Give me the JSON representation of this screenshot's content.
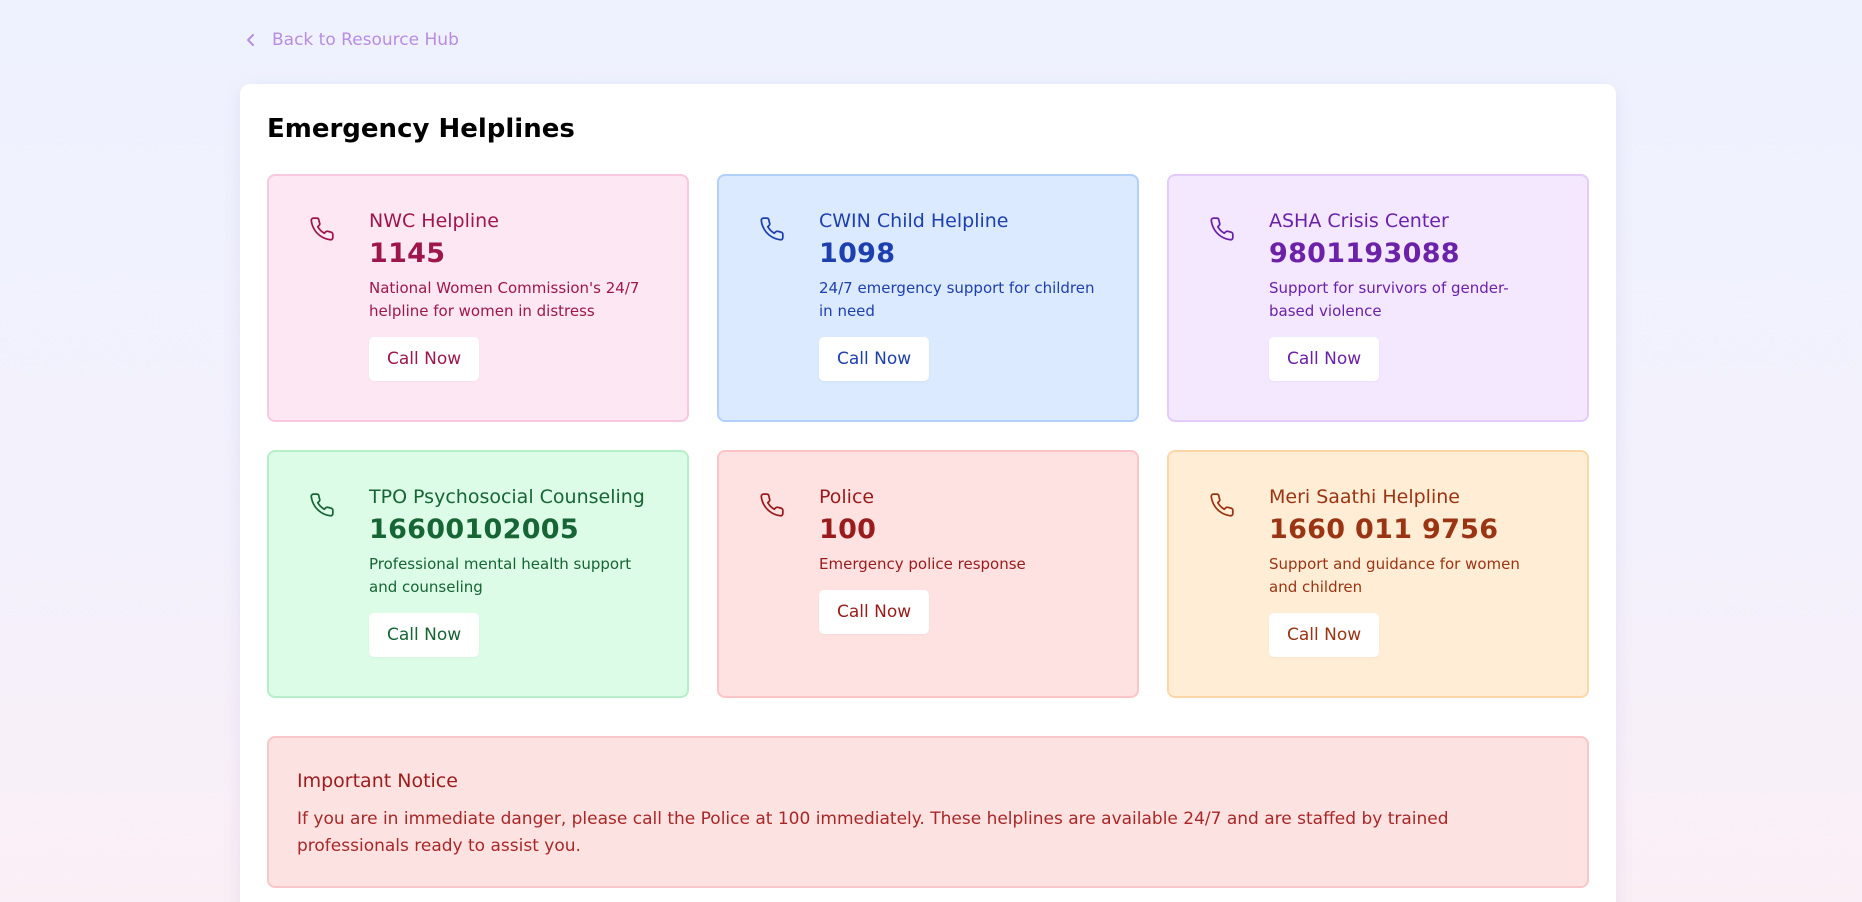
{
  "nav": {
    "back_label": "Back to Resource Hub",
    "back_icon": "chevron-left-icon",
    "color": "#b98ce0"
  },
  "page": {
    "title": "Emergency Helplines"
  },
  "helplines": [
    {
      "name": "NWC Helpline",
      "number": "1145",
      "description": "National Women Commission's 24/7 helpline for women in distress",
      "button": "Call Now",
      "icon": "phone-icon",
      "colors": {
        "bg": "#fce7f3",
        "border": "#f8c8e0",
        "text": "#9d174d"
      }
    },
    {
      "name": "CWIN Child Helpline",
      "number": "1098",
      "description": "24/7 emergency support for children in need",
      "button": "Call Now",
      "icon": "phone-icon",
      "colors": {
        "bg": "#dbeafe",
        "border": "#b3d0fb",
        "text": "#1e40af"
      }
    },
    {
      "name": "ASHA Crisis Center",
      "number": "9801193088",
      "description": "Support for survivors of gender-based violence",
      "button": "Call Now",
      "icon": "phone-icon",
      "colors": {
        "bg": "#f3e8ff",
        "border": "#e4cbfb",
        "text": "#6b21a8"
      }
    },
    {
      "name": "TPO Psychosocial Counseling",
      "number": "16600102005",
      "description": "Professional mental health support and counseling",
      "button": "Call Now",
      "icon": "phone-icon",
      "colors": {
        "bg": "#dcfce7",
        "border": "#b5efc9",
        "text": "#166534"
      }
    },
    {
      "name": "Police",
      "number": "100",
      "description": "Emergency police response",
      "button": "Call Now",
      "icon": "phone-icon",
      "colors": {
        "bg": "#fee2e2",
        "border": "#fbc5c8",
        "text": "#991b1b"
      }
    },
    {
      "name": "Meri Saathi Helpline",
      "number": "1660 011 9756",
      "description": "Support and guidance for women and children",
      "button": "Call Now",
      "icon": "phone-icon",
      "colors": {
        "bg": "#ffedd5",
        "border": "#fbd7a8",
        "text": "#9a3412"
      }
    }
  ],
  "notice": {
    "title": "Important Notice",
    "text": "If you are in immediate danger, please call the Police at 100 immediately. These helplines are available 24/7 and are staffed by trained professionals ready to assist you."
  }
}
